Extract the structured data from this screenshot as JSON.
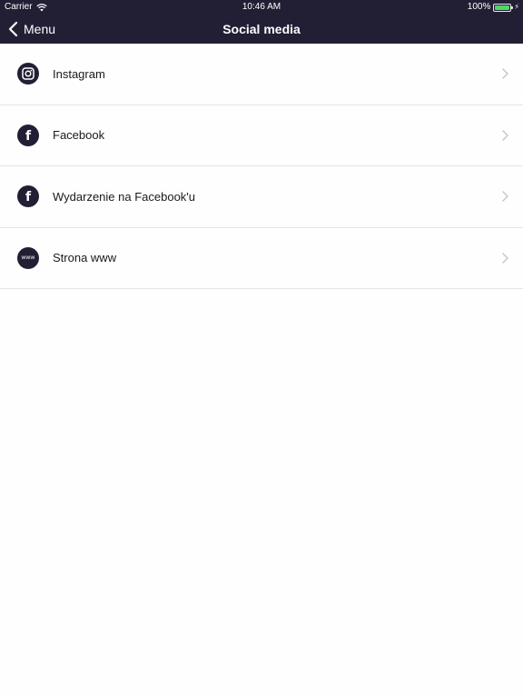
{
  "status_bar": {
    "carrier": "Carrier",
    "time": "10:46 AM",
    "battery": "100%",
    "battery_level": 1.0
  },
  "nav": {
    "back_label": "Menu",
    "title": "Social media"
  },
  "items": [
    {
      "label": "Instagram",
      "icon": "instagram-icon"
    },
    {
      "label": "Facebook",
      "icon": "facebook-icon"
    },
    {
      "label": "Wydarzenie na Facebook'u",
      "icon": "facebook-icon"
    },
    {
      "label": "Strona www",
      "icon": "www-icon",
      "icon_text": "www"
    }
  ],
  "colors": {
    "bar": "#221f35",
    "icon_bg": "#221f35",
    "battery": "#4cd964",
    "divider": "#e5e5e5"
  }
}
